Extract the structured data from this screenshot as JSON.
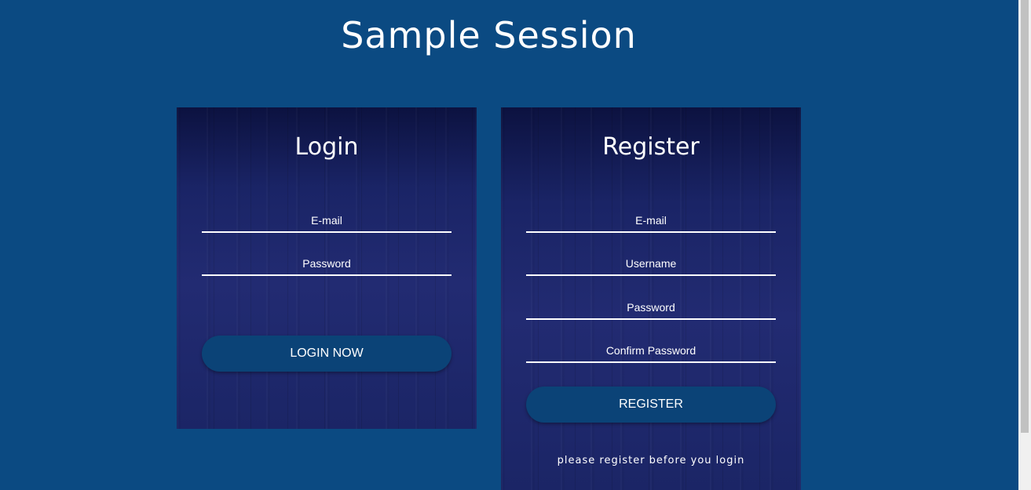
{
  "page": {
    "title": "Sample Session"
  },
  "login": {
    "title": "Login",
    "email_placeholder": "E-mail",
    "password_placeholder": "Password",
    "button_label": "LOGIN NOW"
  },
  "register": {
    "title": "Register",
    "email_placeholder": "E-mail",
    "username_placeholder": "Username",
    "password_placeholder": "Password",
    "confirm_password_placeholder": "Confirm Password",
    "button_label": "REGISTER",
    "note": "please register before you login"
  },
  "colors": {
    "background": "#0b4a82",
    "card_dark": "#0c1240",
    "card_mid": "#222b72",
    "button": "#0b4377",
    "text": "#ffffff"
  }
}
